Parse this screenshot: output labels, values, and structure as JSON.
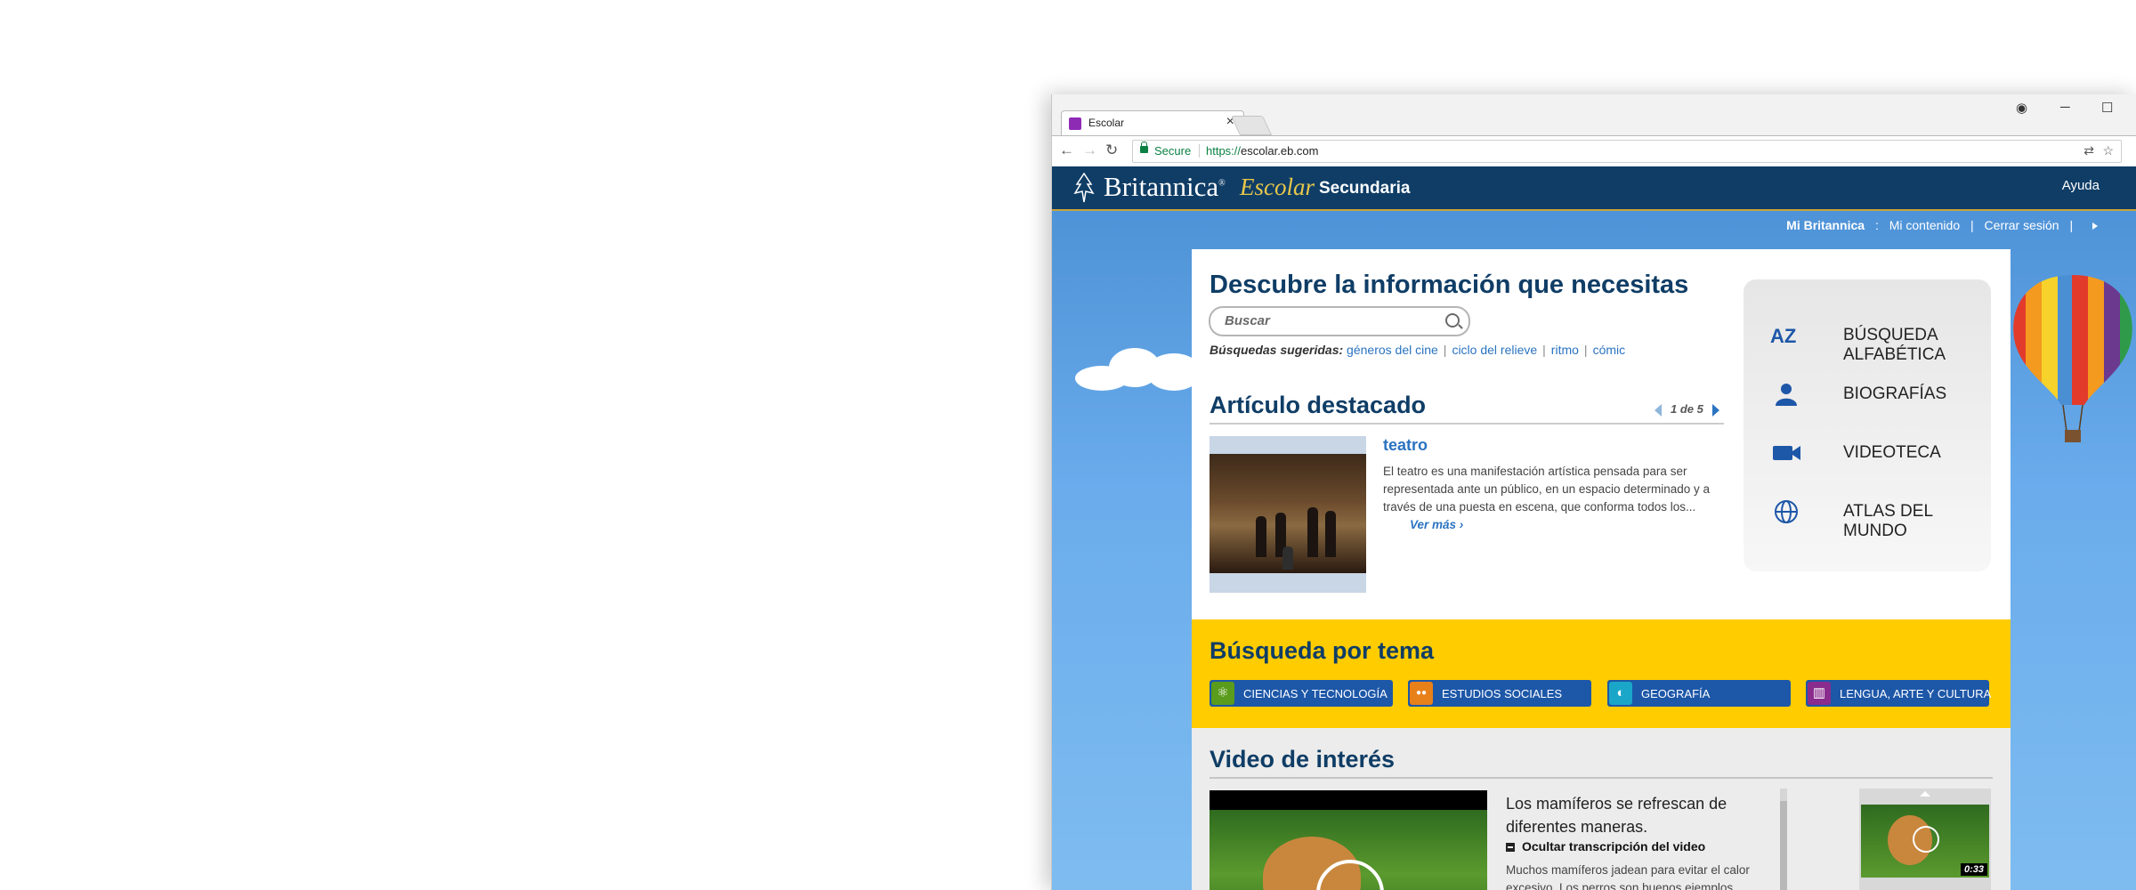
{
  "browser": {
    "tab_title": "Escolar",
    "close_glyph": "×",
    "secure_label": "Secure",
    "url_scheme": "https://",
    "url_host": "escolar.eb.com",
    "nav": {
      "back": "←",
      "forward": "→",
      "reload": "↻"
    },
    "window_controls": {
      "profile": "◉",
      "minimize": "─",
      "maximize": "☐"
    },
    "omni_icons": {
      "translate": "⇄",
      "star": "☆"
    }
  },
  "site": {
    "logo_britannica": "Britannica",
    "logo_reg": "®",
    "logo_escolar": "Escolar",
    "logo_level": "Secundaria",
    "help_link": "Ayuda",
    "user_bar": {
      "account": "Mi Britannica",
      "colon": ":",
      "my_content": "Mi contenido",
      "sep": "|",
      "logout": "Cerrar sesión"
    }
  },
  "hero": {
    "title": "Descubre la información que necesitas",
    "search_placeholder": "Buscar",
    "suggested_label": "Búsquedas sugeridas:",
    "suggestions": [
      "géneros del cine",
      "ciclo del relieve",
      "ritmo",
      "cómic"
    ],
    "sep": "|"
  },
  "featured": {
    "title": "Artículo destacado",
    "pager": "1 de 5",
    "article_title": "teatro",
    "article_summary": "El teatro es una manifestación artística pensada para ser representada ante un público, en un espacio determinado y a través de una puesta en escena, que conforma todos los...",
    "read_more": "Ver más ›"
  },
  "quick_links": [
    {
      "label": "BÚSQUEDA ALFABÉTICA",
      "icon": "az-icon"
    },
    {
      "label": "BIOGRAFÍAS",
      "icon": "person-icon"
    },
    {
      "label": "VIDEOTECA",
      "icon": "video-camera-icon"
    },
    {
      "label": "ATLAS DEL MUNDO",
      "icon": "globe-icon"
    }
  ],
  "topics": {
    "title": "Búsqueda por tema",
    "items": [
      {
        "label": "CIENCIAS Y TECNOLOGÍA",
        "icon": "atom-icon",
        "glyph": "⚛",
        "color": "#5a9c1b"
      },
      {
        "label": "ESTUDIOS SOCIALES",
        "icon": "people-icon",
        "glyph": "●●",
        "color": "#e8801a"
      },
      {
        "label": "GEOGRAFÍA",
        "icon": "globe-icon",
        "glyph": "◐",
        "color": "#1aa6c8"
      },
      {
        "label": "LENGUA, ARTE Y CULTURA",
        "icon": "museum-icon",
        "glyph": "▥",
        "color": "#8a2b8e"
      }
    ]
  },
  "video": {
    "title": "Video de interés",
    "caption": "Los mamíferos se refrescan de diferentes maneras.",
    "transcript_toggle": "Ocultar transcripción del video",
    "transcript_text": "Muchos mamíferos jadean para evitar el calor excesivo. Los perros son buenos ejemplos",
    "thumb_duration": "0:33"
  },
  "colors": {
    "header_bg": "#0f3d66",
    "accent_gold": "#e8c84a",
    "link_blue": "#2a73c1",
    "topic_bar": "#ffcc00",
    "topic_button": "#1d57a8"
  }
}
